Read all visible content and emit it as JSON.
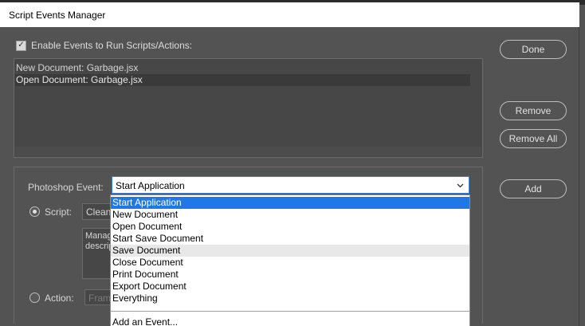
{
  "dialog": {
    "title": "Script Events Manager"
  },
  "enable_events": {
    "label": "Enable Events to Run Scripts/Actions:",
    "checked": true
  },
  "script_list": [
    {
      "label": "New Document: Garbage.jsx",
      "selected": false
    },
    {
      "label": "Open Document: Garbage.jsx",
      "selected": true
    }
  ],
  "buttons": {
    "done": "Done",
    "remove": "Remove",
    "remove_all": "Remove All",
    "add": "Add"
  },
  "photoshop_event": {
    "label": "Photoshop Event:",
    "selected": "Start Application"
  },
  "script": {
    "label": "Script:",
    "value": "Clean Listing",
    "selected": true
  },
  "description": {
    "line1": "Manag",
    "line2": "descrip"
  },
  "action": {
    "label": "Action:",
    "value": "Frame",
    "selected": false
  },
  "dropdown": {
    "items": [
      "Start Application",
      "New Document",
      "Open Document",
      "Start Save Document",
      "Save Document",
      "Close Document",
      "Print Document",
      "Export Document",
      "Everything"
    ],
    "highlighted": "Start Application",
    "hovered": "Save Document",
    "add_event": "Add an Event..."
  },
  "icons": {
    "select_arrow": "chevron-down-icon",
    "checkbox": "checkmark-icon"
  }
}
